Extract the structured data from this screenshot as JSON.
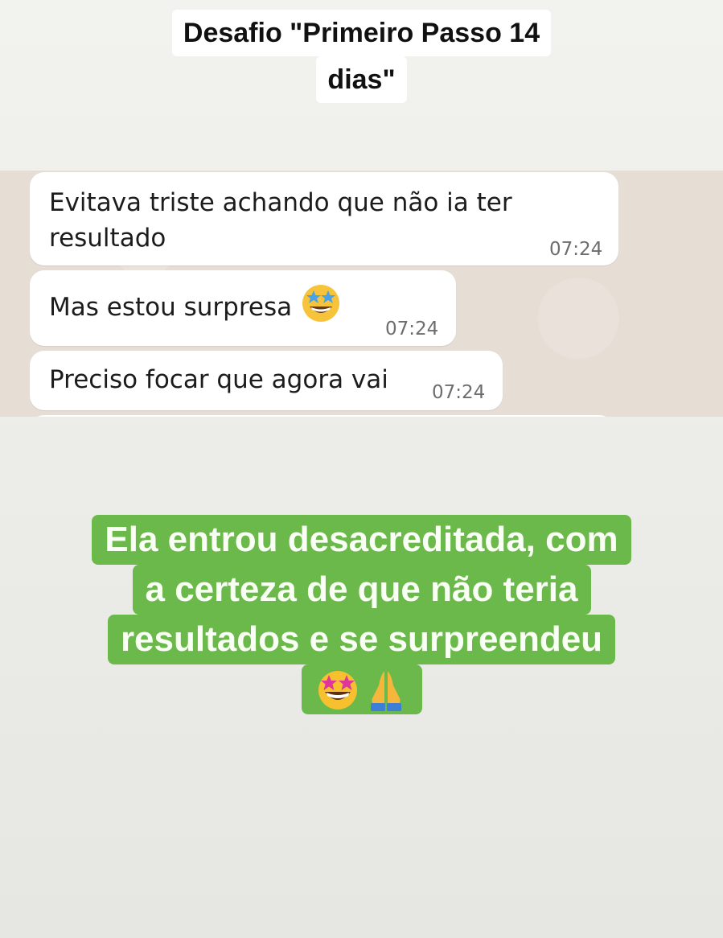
{
  "header": {
    "title_line1": "Desafio \"Primeiro Passo 14",
    "title_line2": "dias\""
  },
  "messages": [
    {
      "text_line1": "Evitava triste achando que não ia ter",
      "text_line2": "resultado",
      "time": "07:24"
    },
    {
      "text": "Mas estou surpresa",
      "emoji": "star-struck-emoji-icon",
      "time": "07:24"
    },
    {
      "text": "Preciso focar que agora vai",
      "time": "07:24"
    }
  ],
  "caption": {
    "line1": "Ela entrou desacreditada, com",
    "line2": "a certeza de que não teria",
    "line3": "resultados e se surpreendeu",
    "emojis": [
      "star-struck-emoji-icon",
      "folded-hands-emoji-icon"
    ]
  },
  "colors": {
    "caption_bg": "#6ab94a",
    "chat_bg": "#e6ddd4",
    "bubble_bg": "#ffffff"
  }
}
